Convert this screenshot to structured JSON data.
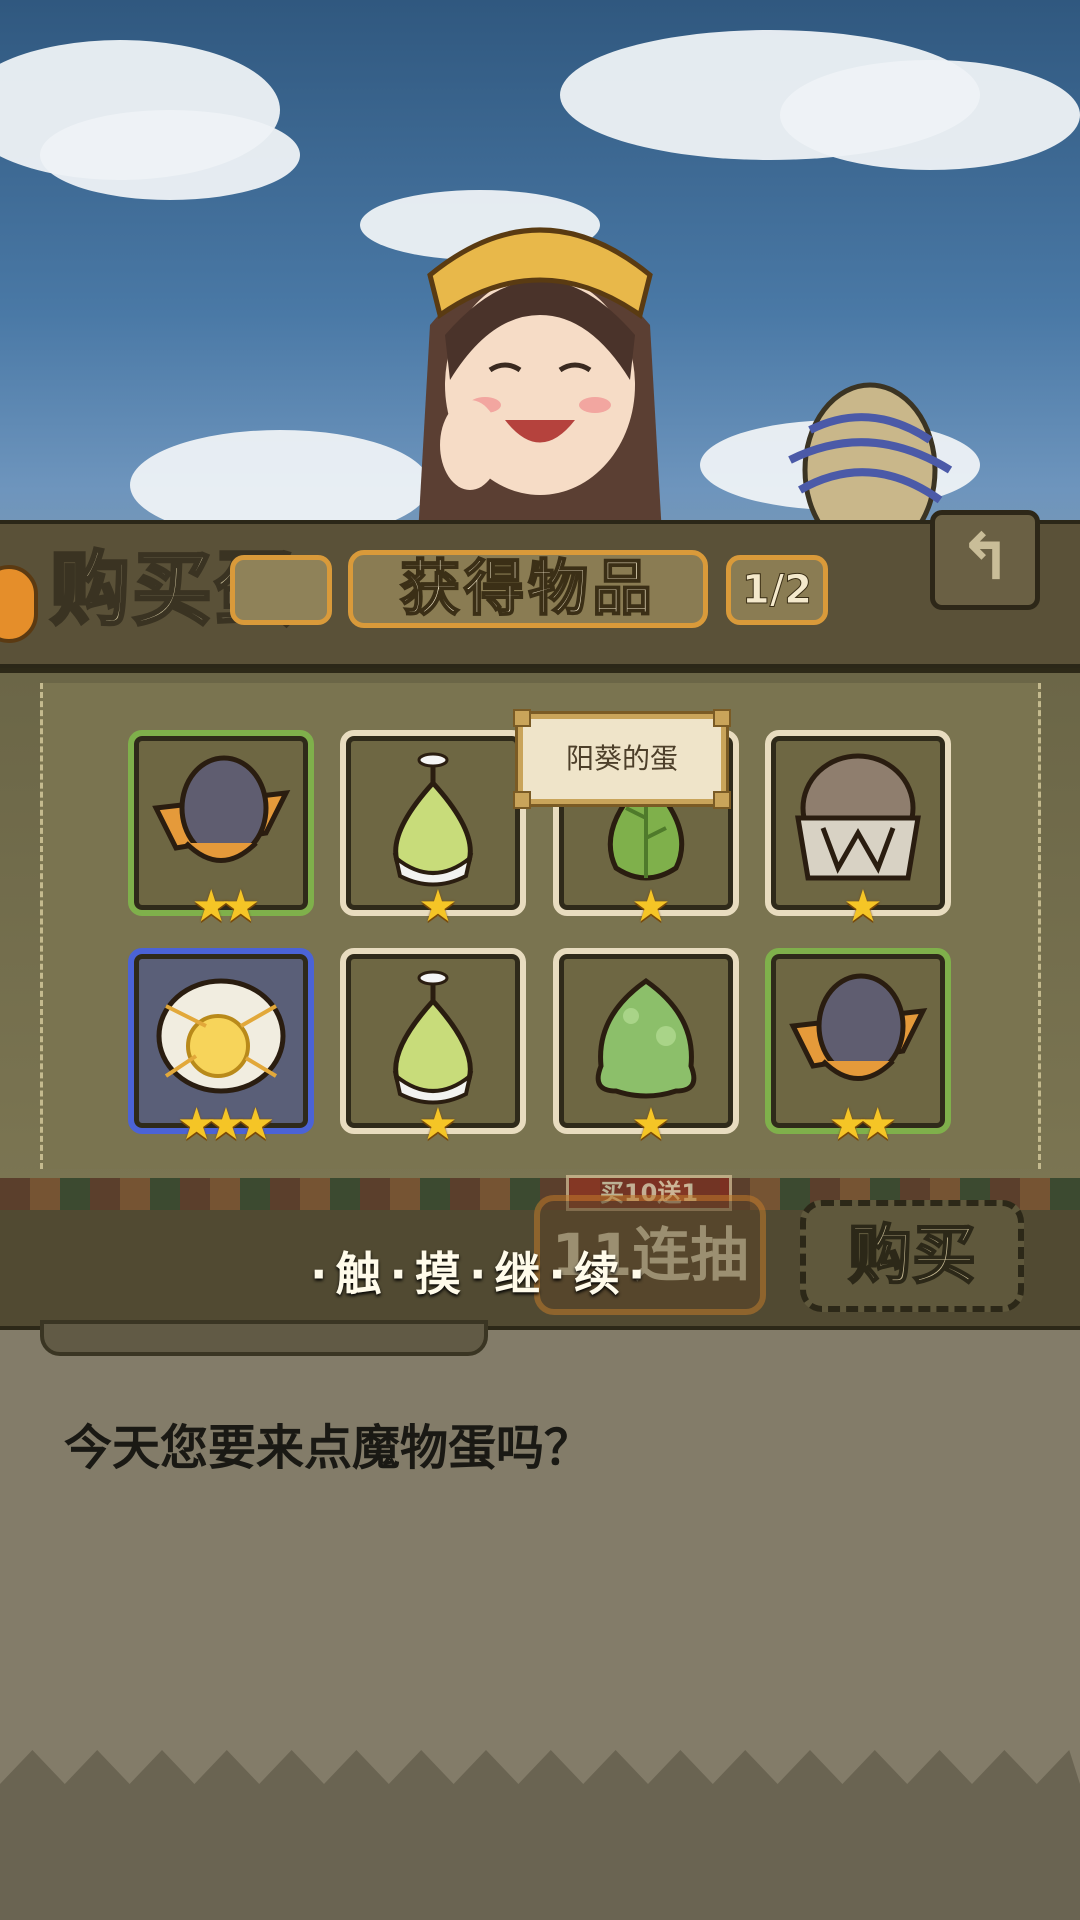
{
  "header": {
    "shop_title": "购买蛋",
    "dialog_title": "获得物品",
    "page_indicator": "1/2",
    "back_icon": "back-arrow-icon"
  },
  "tooltip": {
    "text": "阳葵的蛋"
  },
  "items": [
    {
      "name": "hat-egg",
      "frame": "green",
      "stars": 2
    },
    {
      "name": "bulb-egg",
      "frame": "white",
      "stars": 1
    },
    {
      "name": "leaf-egg",
      "frame": "white",
      "stars": 1
    },
    {
      "name": "mimic-egg",
      "frame": "white",
      "stars": 1
    },
    {
      "name": "sun-egg",
      "frame": "blue",
      "stars": 3
    },
    {
      "name": "bulb-egg",
      "frame": "white",
      "stars": 1
    },
    {
      "name": "slime-egg",
      "frame": "white",
      "stars": 1
    },
    {
      "name": "hat-egg",
      "frame": "green",
      "stars": 2
    }
  ],
  "bottom": {
    "continue_text": "·触·摸·继·续·",
    "ten_pull_tag": "买10送1",
    "ten_pull_label": "11连抽",
    "buy_label": "购买"
  },
  "dialog_text": "今天您要来点魔物蛋吗？"
}
